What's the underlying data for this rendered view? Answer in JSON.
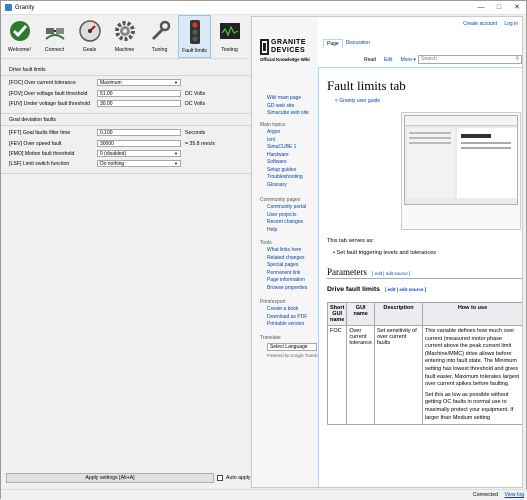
{
  "window": {
    "title": "Granity"
  },
  "toolbar": {
    "buttons": [
      {
        "label": "Welcome!",
        "icon": "granity-logo-icon"
      },
      {
        "label": "Connect",
        "icon": "connect-icon"
      },
      {
        "label": "Goals",
        "icon": "gauge-icon"
      },
      {
        "label": "Machine",
        "icon": "gear-icon"
      },
      {
        "label": "Tuning",
        "icon": "wrench-icon"
      },
      {
        "label": "Fault limits",
        "icon": "traffic-light-icon"
      },
      {
        "label": "Testing",
        "icon": "scope-icon"
      }
    ],
    "active": "Fault limits"
  },
  "drive_faults": {
    "heading": "Drive fault limits",
    "foc": {
      "label": "[FOC] Over current tolerance",
      "value": "Maximum"
    },
    "fov": {
      "label": "[FOV] Over voltage fault threshold",
      "value": "51.00",
      "unit": "DC Volts"
    },
    "fuv": {
      "label": "[FUV] Under voltage fault threshold",
      "value": "30.00",
      "unit": "DC Volts"
    }
  },
  "goal_faults": {
    "heading": "Goal deviation faults",
    "fft": {
      "label": "[FFT] Goal faults filter time",
      "value": "0.100",
      "unit": "Seconds"
    },
    "fev": {
      "label": "[FEV] Over speed fault",
      "value": "30000",
      "unit": "= 35.8 revs/s"
    },
    "fmo": {
      "label": "[FMO] Motion fault threshold",
      "value": "0 (disabled)"
    },
    "lsf": {
      "label": "[LSF] Limit switch function",
      "value": "Do nothing"
    }
  },
  "apply": {
    "label": "Apply settings [Alt+A]",
    "auto_label": "Auto apply",
    "auto_checked": false
  },
  "status": {
    "connection": "Connected",
    "view_log": "View log"
  },
  "wiki": {
    "top_links": [
      "Create account",
      "Log in"
    ],
    "tabs": [
      "Page",
      "Discussion"
    ],
    "view_tabs": [
      "Read",
      "Edit",
      "More ▾"
    ],
    "search_placeholder": "Search",
    "logo_line1": "GRANITE",
    "logo_line2": "DEVICES",
    "logo_line3": "Official Knowledge Wiki",
    "nav_main": [
      "Wiki main page",
      "GD web site",
      "Simucube web site"
    ],
    "nav_topics_heading": "Main topics",
    "nav_topics": [
      "Argon",
      "Ioni",
      "SimuCUBE 1",
      "Hardware",
      "Software",
      "Setup guides",
      "Troubleshooting",
      "Glossary"
    ],
    "nav_community_heading": "Community pages",
    "nav_community": [
      "Community portal",
      "User projects",
      "Recent changes",
      "Help"
    ],
    "nav_tools_heading": "Tools",
    "nav_tools": [
      "What links here",
      "Related changes",
      "Special pages",
      "Permanent link",
      "Page information",
      "Browse properties"
    ],
    "nav_print_heading": "Print/export",
    "nav_print": [
      "Create a book",
      "Download as PDF",
      "Printable version"
    ],
    "translate_heading": "Translate",
    "language_select": "Select Language",
    "powered_by": "Powered by Google Translate",
    "title": "Fault limits tab",
    "back_link": "< Granity user guide",
    "intro": "This tab serves as:",
    "bullet": "Set fault triggering levels and tolerances",
    "h2_parameters": "Parameters",
    "edit_link": "edit",
    "edit_source_link": "edit source",
    "h3_drive": "Drive fault limits",
    "table": {
      "headers": [
        "Short GUI name",
        "GUI name",
        "Description",
        "How to use"
      ],
      "row": {
        "short": "FOC",
        "name": "Over current tolerance",
        "desc": "Set sensitivity of over current faults",
        "how1": "This variable defines how much over current (measured motor phase current above the peak current limit (Machine/MMC) drive allows before entering into fault state. The Minimum setting has lowest threshold and gives fault easier, Maximum tolerates largest over current spikes before faulting.",
        "how2": "Set this as low as possible without getting OC faults in normal use to maximally protect your equipment. If larger than Medium setting"
      }
    }
  }
}
